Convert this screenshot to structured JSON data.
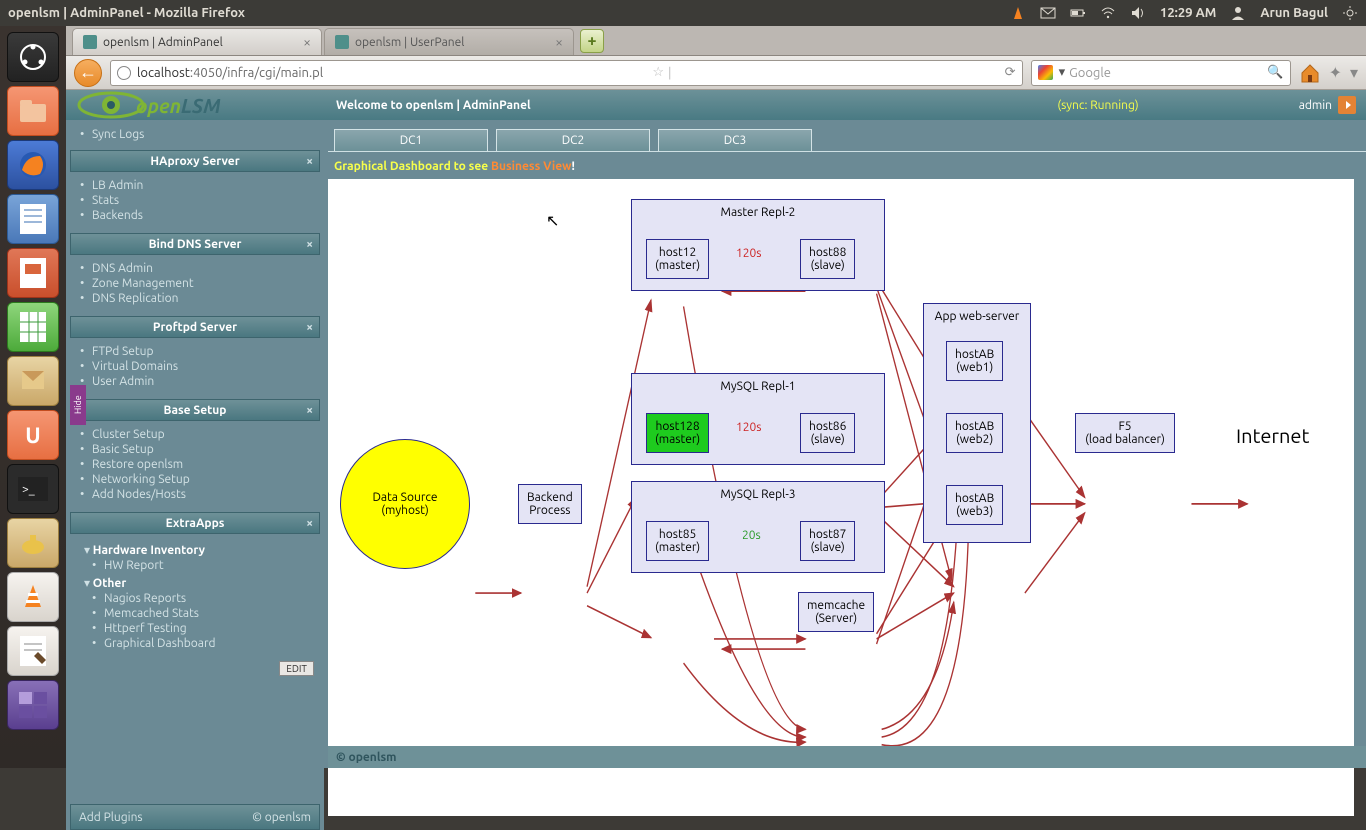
{
  "os": {
    "window_title": "openlsm | AdminPanel - Mozilla Firefox",
    "clock": "12:29 AM",
    "user": "Arun Bagul"
  },
  "browser": {
    "tabs": [
      {
        "label": "openlsm | AdminPanel",
        "active": true
      },
      {
        "label": "openlsm | UserPanel",
        "active": false
      }
    ],
    "url_host": "localhost",
    "url_rest": ":4050/infra/cgi/main.pl",
    "search_placeholder": "Google"
  },
  "app": {
    "welcome": "Welcome to openlsm | AdminPanel",
    "sync": "(sync: Running)",
    "user": "admin",
    "brand_o": "open",
    "brand_rest": "LSM"
  },
  "sidebar": {
    "sync_logs": "Sync Logs",
    "panels": [
      {
        "title": "HAproxy Server",
        "items": [
          "LB Admin",
          "Stats",
          "Backends"
        ]
      },
      {
        "title": "Bind DNS Server",
        "items": [
          "DNS Admin",
          "Zone Management",
          "DNS Replication"
        ]
      },
      {
        "title": "Proftpd Server",
        "items": [
          "FTPd Setup",
          "Virtual Domains",
          "User Admin"
        ]
      },
      {
        "title": "Base Setup",
        "items": [
          "Cluster Setup",
          "Basic Setup",
          "Restore openlsm",
          "Networking Setup",
          "Add Nodes/Hosts"
        ]
      },
      {
        "title": "ExtraApps",
        "groups": [
          {
            "label": "Hardware Inventory",
            "items": [
              "HW Report"
            ]
          },
          {
            "label": "Other",
            "items": [
              "Nagios Reports",
              "Memcached Stats",
              "Httperf Testing",
              "Graphical Dashboard"
            ]
          }
        ]
      }
    ],
    "edit": "EDIT",
    "footer_left": "Add Plugins",
    "footer_right": "© openlsm",
    "hide": "Hide"
  },
  "main": {
    "dcs": [
      "DC1",
      "DC2",
      "DC3"
    ],
    "note_a": "Graphical Dashboard to see ",
    "note_b": "Business View",
    "note_c": "!"
  },
  "diagram": {
    "data_source_l1": "Data Source",
    "data_source_l2": "(myhost)",
    "backend_l1": "Backend",
    "backend_l2": "Process",
    "grp_master2": "Master Repl-2",
    "grp_mysql1": "MySQL Repl-1",
    "grp_mysql3": "MySQL Repl-3",
    "grp_app": "App web-server",
    "h12_l1": "host12",
    "h12_l2": "(master)",
    "h88_l1": "host88",
    "h88_l2": "(slave)",
    "h128_l1": "host128",
    "h128_l2": "(master)",
    "h86_l1": "host86",
    "h86_l2": "(slave)",
    "h85_l1": "host85",
    "h85_l2": "(master)",
    "h87_l1": "host87",
    "h87_l2": "(slave)",
    "ab1_l1": "hostAB",
    "ab1_l2": "(web1)",
    "ab2_l1": "hostAB",
    "ab2_l2": "(web2)",
    "ab3_l1": "hostAB",
    "ab3_l2": "(web3)",
    "f5_l1": "F5",
    "f5_l2": "(load balancer)",
    "mem_l1": "memcache",
    "mem_l2": "(Server)",
    "lat120a": "120s",
    "lat120b": "120s",
    "lat20": "20s",
    "internet": "Internet"
  },
  "footer": {
    "text": "© openlsm"
  }
}
